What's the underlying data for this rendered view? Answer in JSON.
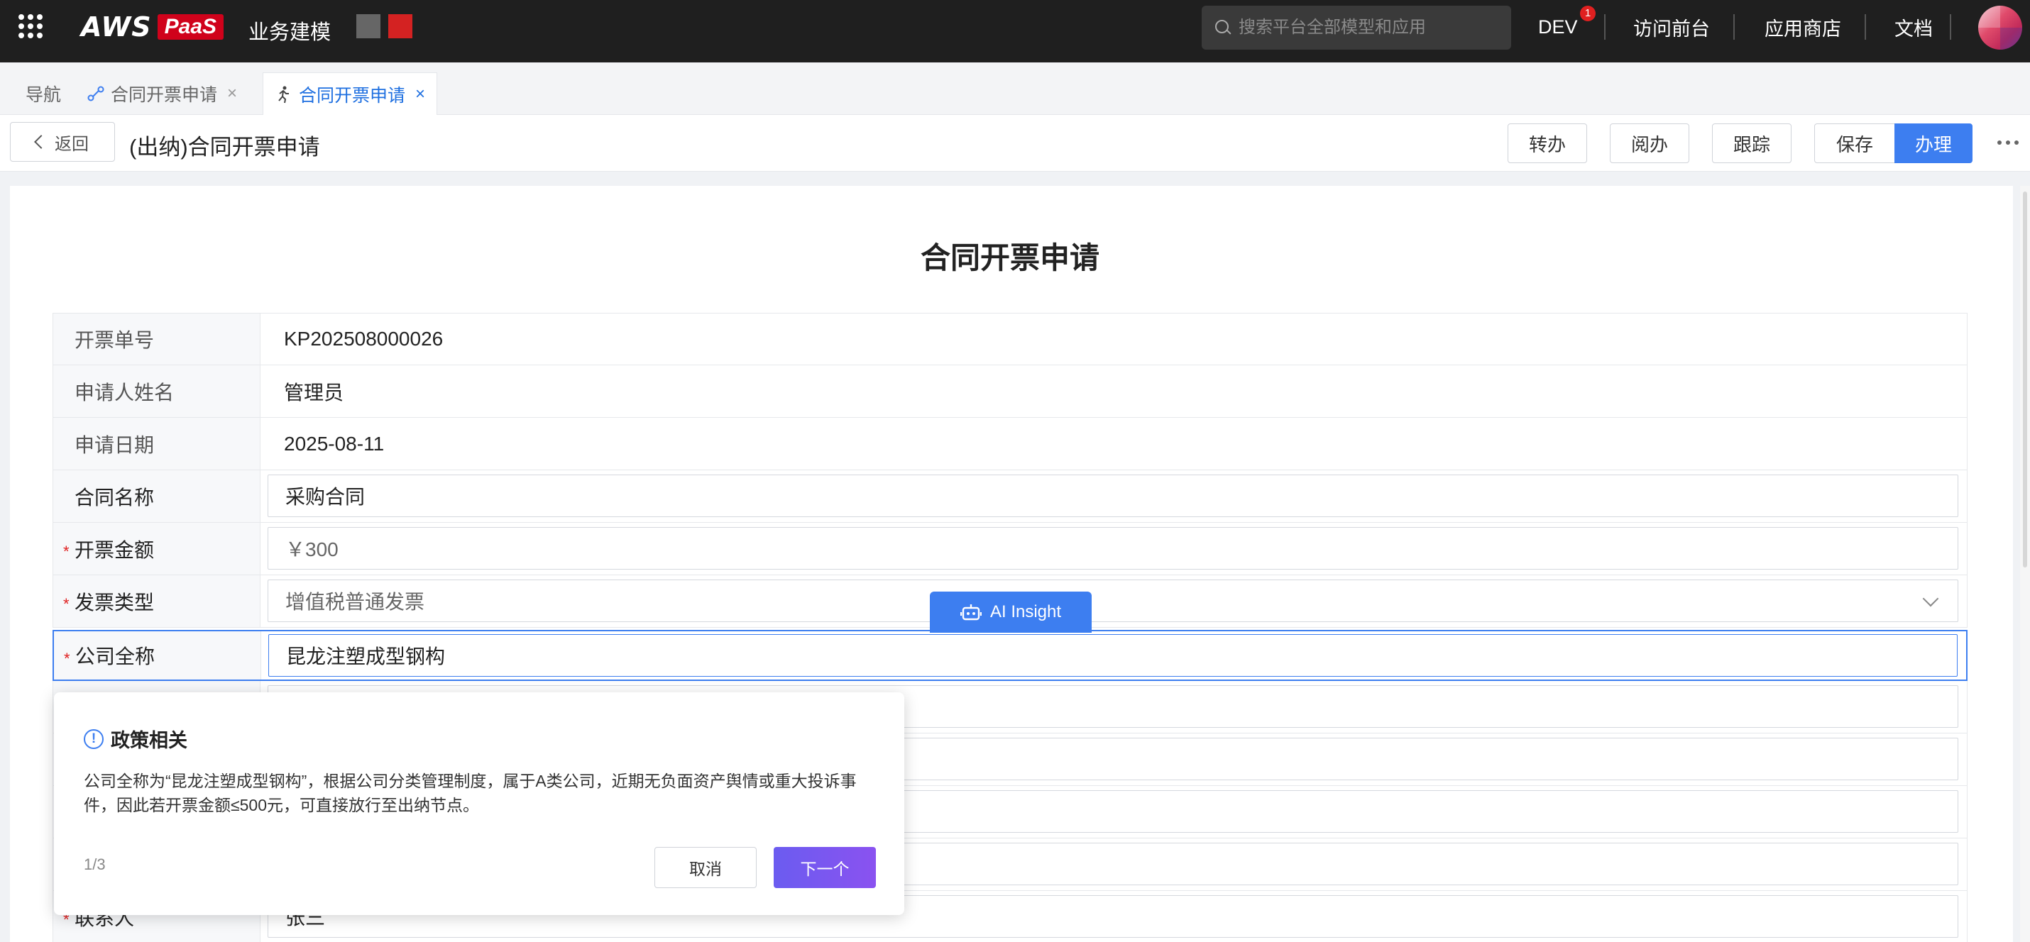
{
  "topbar": {
    "brand_aws": "AWS",
    "brand_paas": "PaaS",
    "app_name": "业务建模",
    "search_placeholder": "搜索平台全部模型和应用",
    "dev_label": "DEV",
    "dev_badge": "1",
    "nav": [
      "访问前台",
      "应用商店",
      "文档"
    ]
  },
  "tabs": {
    "nav_label": "导航",
    "tab1_label": "合同开票申请",
    "tab2_label": "合同开票申请",
    "close_glyph": "×"
  },
  "toolbar": {
    "back_label": "返回",
    "page_title": "(出纳)合同开票申请",
    "buttons": {
      "transfer": "转办",
      "read": "阅办",
      "track": "跟踪",
      "save": "保存",
      "handle": "办理"
    }
  },
  "form": {
    "title": "合同开票申请",
    "rows": [
      {
        "label": "开票单号",
        "value": "KP202508000026"
      },
      {
        "label": "申请人姓名",
        "value": "管理员"
      },
      {
        "label": "申请日期",
        "value": "2025-08-11"
      },
      {
        "label": "合同名称",
        "value": "采购合同"
      },
      {
        "label": "开票金额",
        "value": "￥300",
        "required": true
      },
      {
        "label": "发票类型",
        "value": "增值税普通发票",
        "required": true
      },
      {
        "label": "公司全称",
        "value": "昆龙注塑成型钢构",
        "required": true
      },
      {
        "label": "联系人",
        "value": "张三",
        "required": true
      }
    ],
    "required_mark": "*"
  },
  "ai": {
    "button_label": "AI Insight"
  },
  "popover": {
    "title": "政策相关",
    "info_glyph": "!",
    "body": "公司全称为“昆龙注塑成型钢构”，根据公司分类管理制度，属于A类公司，近期无负面资产舆情或重大投诉事件，因此若开票金额≤500元，可直接放行至出纳节点。",
    "page": "1/3",
    "cancel": "取消",
    "next": "下一个"
  },
  "colors": {
    "topbar_bg": "#1f1f1f",
    "accent": "#3d7ef0",
    "brand_red": "#d0021b",
    "next_button": "#7a57f0",
    "required": "#e02020"
  }
}
